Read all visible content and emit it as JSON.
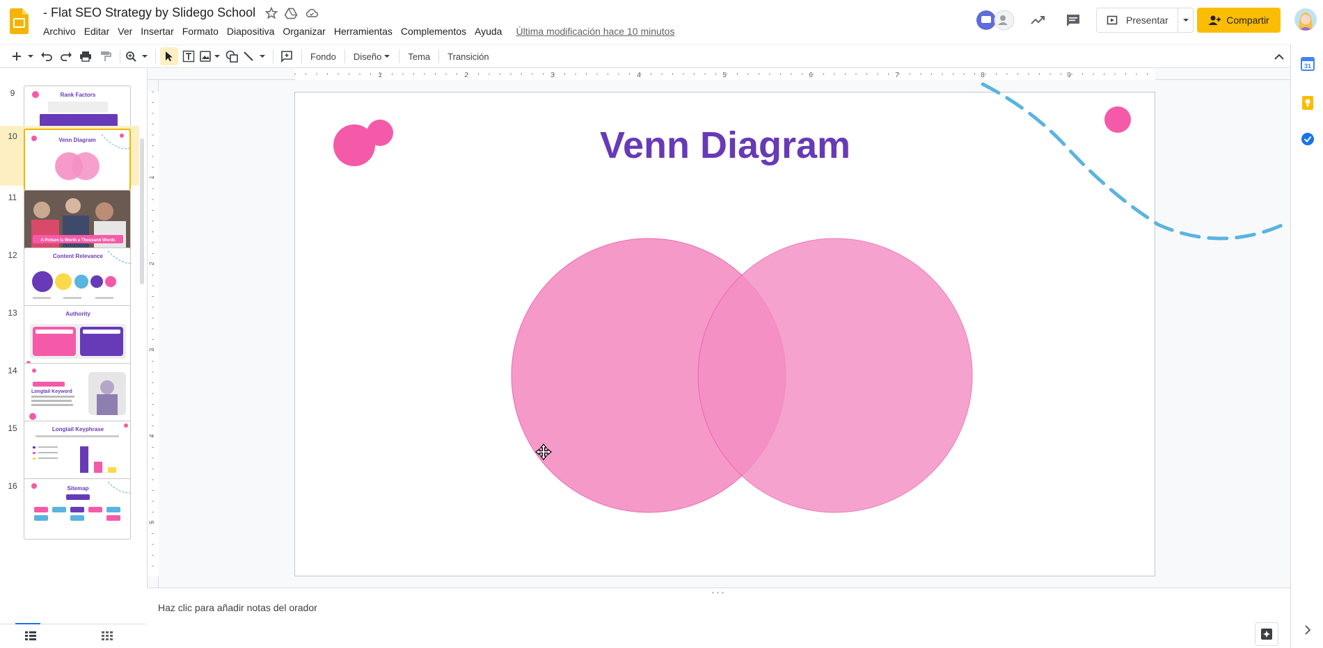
{
  "header": {
    "title": "- Flat SEO Strategy by Slidego School",
    "menu": [
      "Archivo",
      "Editar",
      "Ver",
      "Insertar",
      "Formato",
      "Diapositiva",
      "Organizar",
      "Herramientas",
      "Complementos",
      "Ayuda"
    ],
    "last_edit": "Última modificación hace 10 minutos",
    "present_label": "Presentar",
    "share_label": "Compartir"
  },
  "toolbar": {
    "background_label": "Fondo",
    "layout_label": "Diseño",
    "theme_label": "Tema",
    "transition_label": "Transición"
  },
  "filmstrip": {
    "slides": [
      {
        "number": "9",
        "title": "Rank Factors"
      },
      {
        "number": "10",
        "title": "Venn Diagram",
        "selected": true
      },
      {
        "number": "11",
        "title": "A Picture is Worth a Thousand Words"
      },
      {
        "number": "12",
        "title": "Content Relevance"
      },
      {
        "number": "13",
        "title": "Authority"
      },
      {
        "number": "14",
        "title": "Longtail Keyword"
      },
      {
        "number": "15",
        "title": "Longtail Keyphrase"
      },
      {
        "number": "16",
        "title": "Sitemap"
      }
    ]
  },
  "ruler": {
    "h_labels": [
      "1",
      "2",
      "3",
      "4",
      "5",
      "6",
      "7",
      "8",
      "9"
    ],
    "v_labels": [
      "1",
      "2",
      "3",
      "4",
      "5"
    ]
  },
  "slide": {
    "title": "Venn Diagram",
    "title_color": "#673ab7",
    "circle_color": "#f48fc4",
    "overlap_color": "#f06ab0",
    "accent_pink": "#f55aa8",
    "dash_color": "#5ab4e0"
  },
  "notes": {
    "placeholder": "Haz clic para añadir notas del orador"
  },
  "colors": {
    "share_bg": "#fbbc04",
    "selected_bg": "#feefc3"
  }
}
